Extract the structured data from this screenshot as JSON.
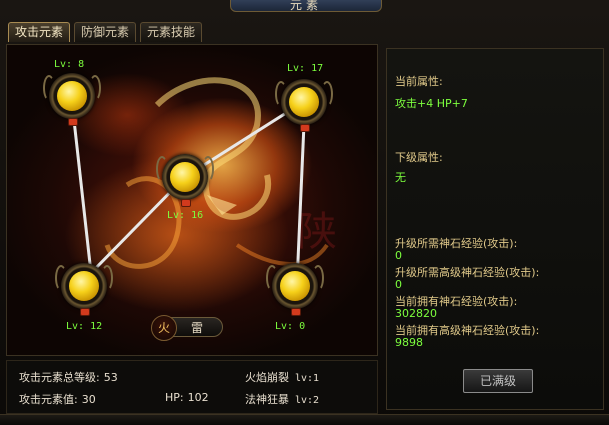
{
  "window": {
    "title": "元素"
  },
  "tabs": [
    {
      "label": "攻击元素",
      "active": true
    },
    {
      "label": "防御元素",
      "active": false
    },
    {
      "label": "元素技能",
      "active": false
    }
  ],
  "nodes": {
    "top_left": {
      "level": "Lv: 8"
    },
    "top_right": {
      "level": "Lv: 17"
    },
    "center": {
      "level": "Lv: 16"
    },
    "bottom_left": {
      "level": "Lv: 12"
    },
    "bottom_right": {
      "level": "Lv: 0"
    }
  },
  "element_toggle": {
    "icon": "火",
    "label": "雷"
  },
  "info": {
    "current_attr_title": "当前属性:",
    "current_attr_value": "攻击+4 HP+7",
    "next_attr_title": "下级属性:",
    "next_attr_value": "无",
    "req_exp_label": "升级所需神石经验(攻击):",
    "req_exp_value": "0",
    "req_high_exp_label": "升级所需高级神石经验(攻击):",
    "req_high_exp_value": "0",
    "own_exp_label": "当前拥有神石经验(攻击):",
    "own_exp_value": "302820",
    "own_high_exp_label": "当前拥有高级神石经验(攻击):",
    "own_high_exp_value": "9898",
    "maxed_button": "已满级"
  },
  "stats": {
    "total_level_label": "攻击元素总等级:",
    "total_level_value": "53",
    "value_label": "攻击元素值:",
    "value_value": "30",
    "hp_label": "HP:",
    "hp_value": "102",
    "skill1_name": "火焰崩裂",
    "skill1_level": "lv:1",
    "skill2_name": "法神狂暴",
    "skill2_level": "lv:2"
  }
}
